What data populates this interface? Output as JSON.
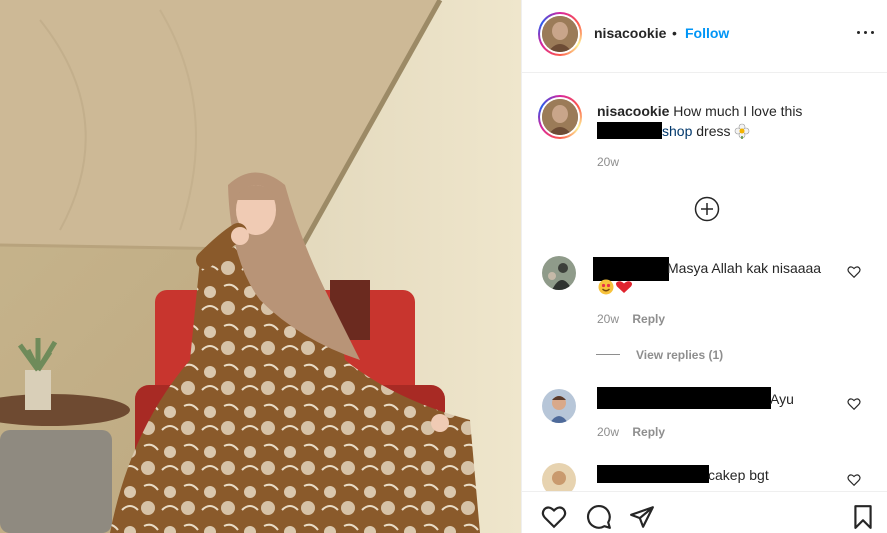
{
  "post": {
    "username": "nisacookie",
    "separator": "•",
    "follow_label": "Follow"
  },
  "caption": {
    "username": "nisacookie",
    "text_before": "How much I love this",
    "shop_text": "shop",
    "text_after": "dress",
    "time": "20w"
  },
  "comments": [
    {
      "text": "Masya Allah kak nisaaaa",
      "time": "20w",
      "reply_label": "Reply",
      "view_replies": "View replies (1)"
    },
    {
      "text": "Ayu",
      "time": "20w",
      "reply_label": "Reply"
    },
    {
      "text": "cakep bgt"
    }
  ],
  "icons": {
    "more": "more-options-icon",
    "load_more": "add-circle-icon",
    "like": "heart-icon",
    "comment": "comment-icon",
    "share": "share-icon",
    "save": "bookmark-icon"
  },
  "colors": {
    "follow": "#0095f6",
    "shop_link": "#00376b",
    "muted": "#8e8e8e",
    "text": "#262626"
  }
}
